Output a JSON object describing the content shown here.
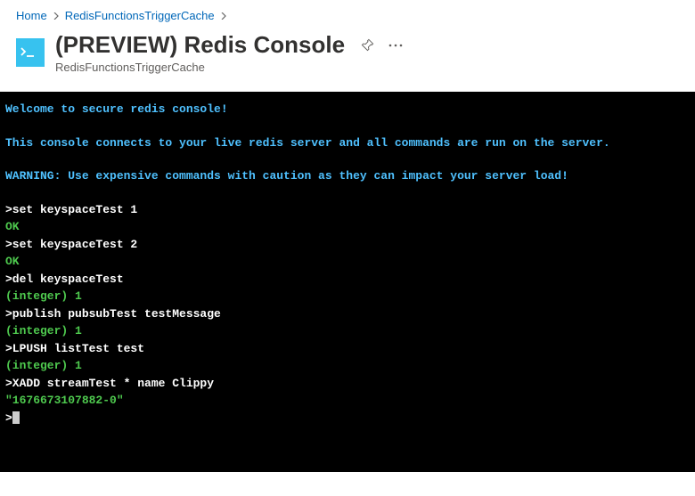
{
  "breadcrumb": {
    "items": [
      "Home",
      "RedisFunctionsTriggerCache"
    ]
  },
  "page": {
    "title": "(PREVIEW) Redis Console",
    "subtitle": "RedisFunctionsTriggerCache"
  },
  "console": {
    "banner1": "Welcome to secure redis console!",
    "banner2": "This console connects to your live redis server and all commands are run on the server.",
    "banner3": "WARNING: Use expensive commands with caution as they can impact your server load!",
    "lines": [
      {
        "text": ">set keyspaceTest 1",
        "class": "command-line"
      },
      {
        "text": "OK",
        "class": "ok"
      },
      {
        "text": ">set keyspaceTest 2",
        "class": "command-line"
      },
      {
        "text": "OK",
        "class": "ok"
      },
      {
        "text": ">del keyspaceTest",
        "class": "command-line"
      },
      {
        "text": "(integer) 1",
        "class": "result-green"
      },
      {
        "text": ">publish pubsubTest testMessage",
        "class": "command-line"
      },
      {
        "text": "(integer) 1",
        "class": "result-green"
      },
      {
        "text": ">LPUSH listTest test",
        "class": "command-line"
      },
      {
        "text": "(integer) 1",
        "class": "result-green"
      },
      {
        "text": ">XADD streamTest * name Clippy",
        "class": "command-line"
      },
      {
        "text": "\"1676673107882-0\"",
        "class": "result-green"
      }
    ],
    "prompt": ">"
  }
}
